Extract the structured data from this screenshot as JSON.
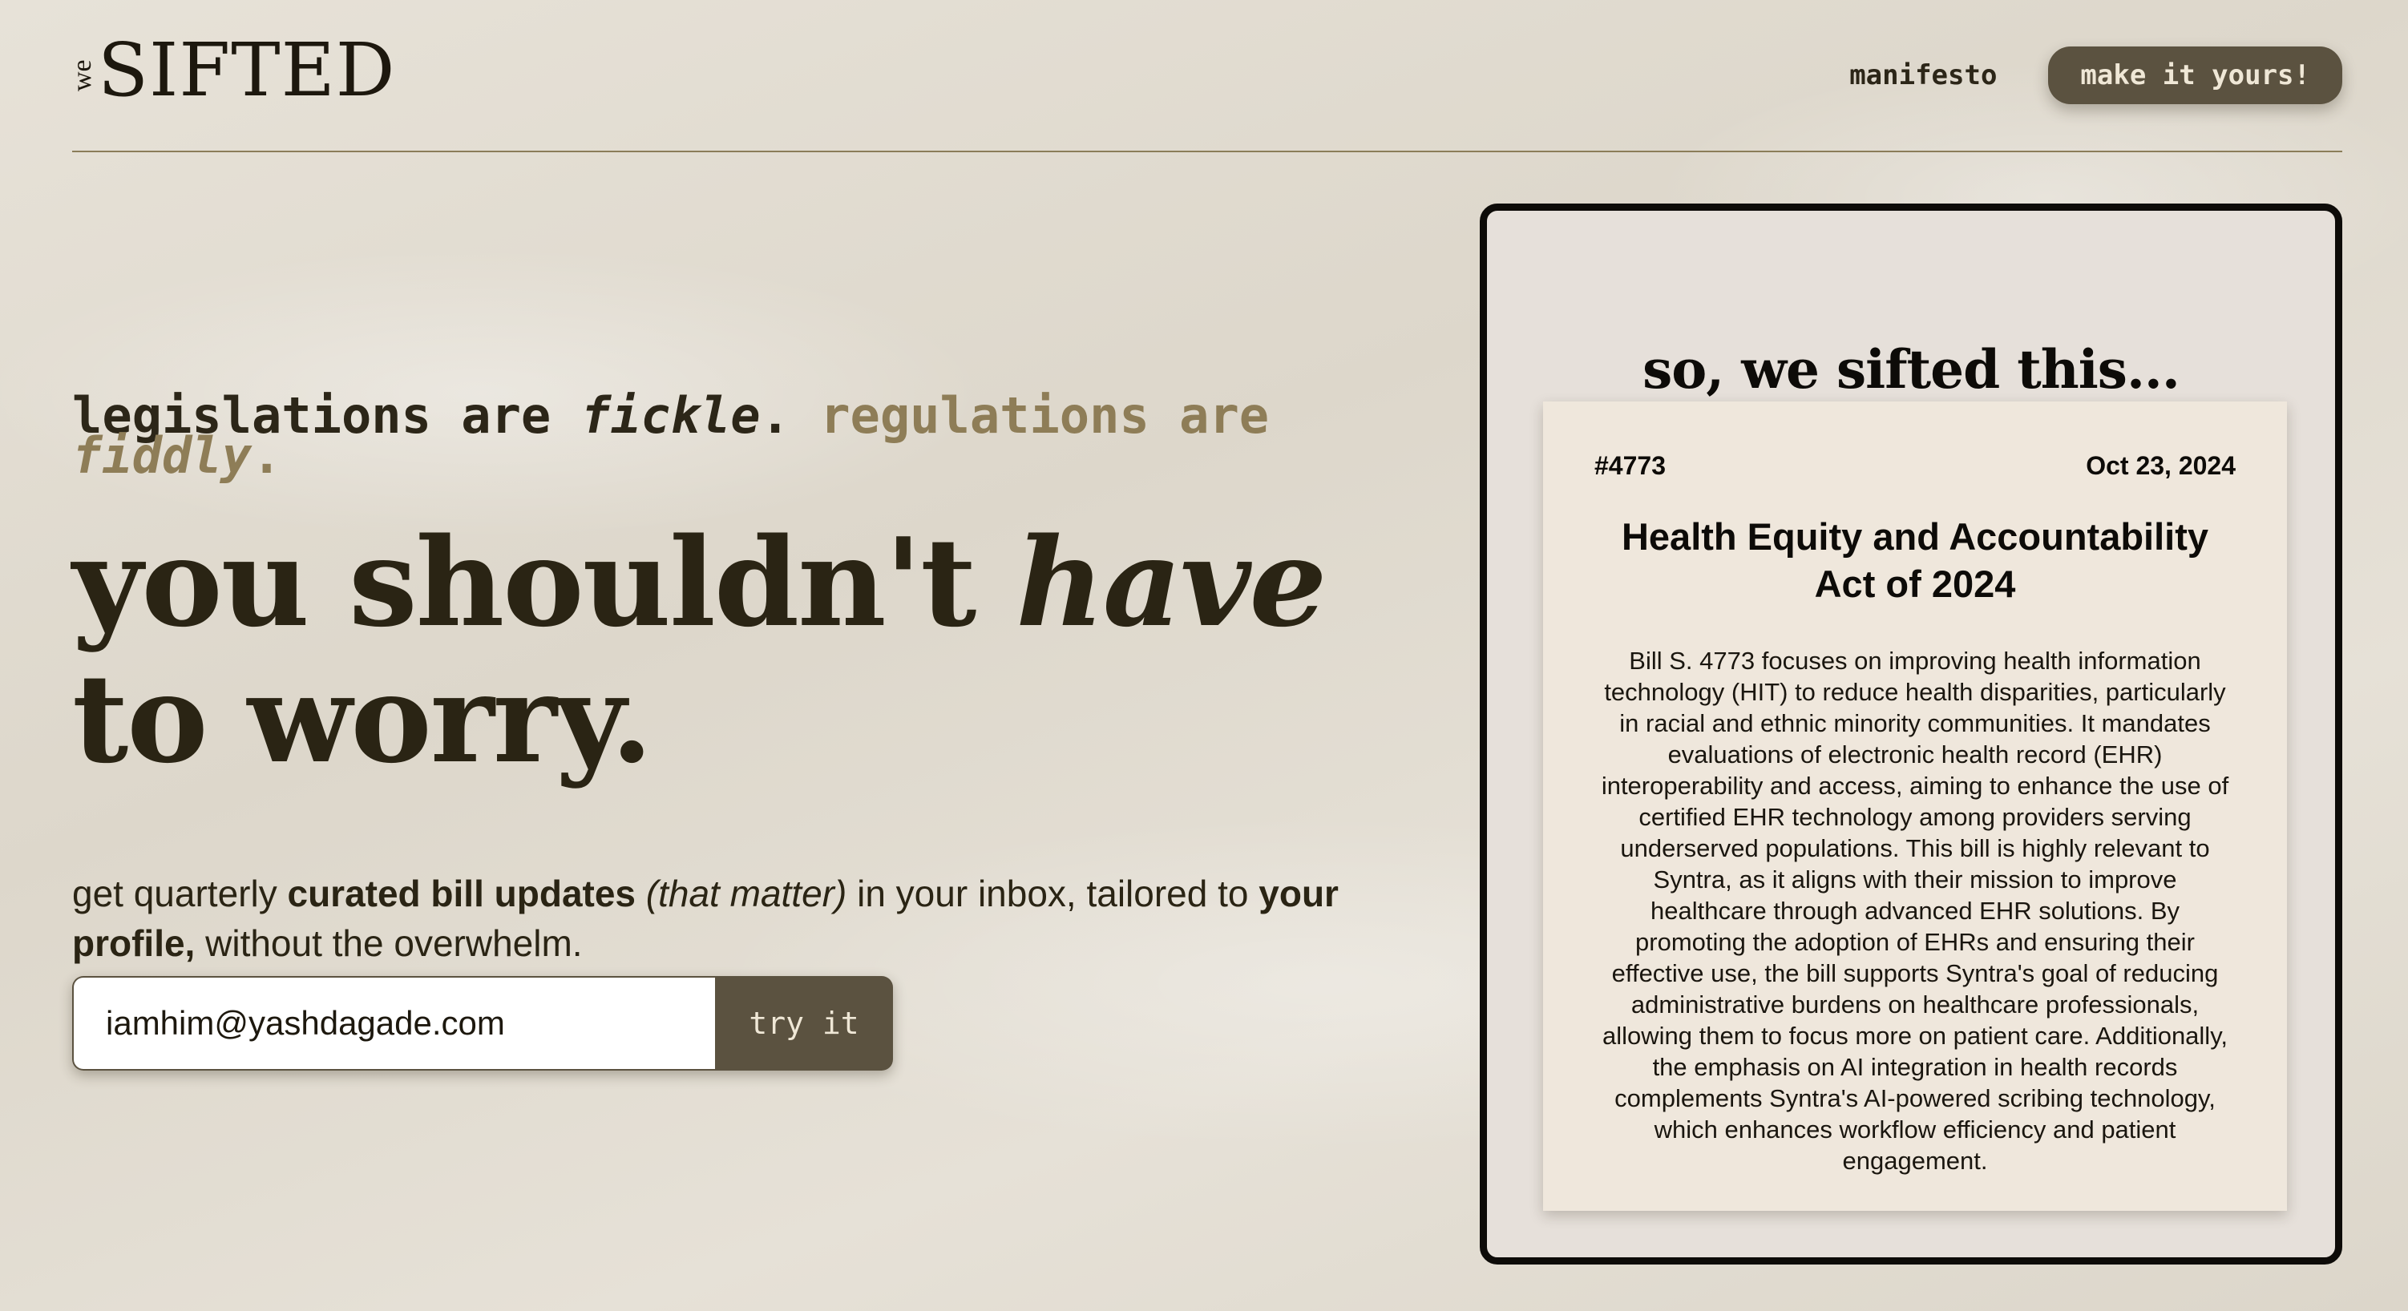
{
  "header": {
    "logo_prefix": "we",
    "logo_name": "SIFTED",
    "nav_manifesto": "manifesto",
    "nav_cta": "make it yours!"
  },
  "hero": {
    "tagline_part1": "legislations are ",
    "tagline_fickle": "fickle",
    "tagline_dot1": ". ",
    "tagline_part2": "regulations are ",
    "tagline_fiddly": "fiddly",
    "tagline_dot2": ".",
    "headline_part1": "you shouldn't ",
    "headline_have": "have",
    "headline_part2": " to worry.",
    "sub_part1": "get quarterly ",
    "sub_bold1": "curated bill updates",
    "sub_italic": " (that matter)",
    "sub_part2": " in your inbox, tailored to ",
    "sub_bold2": "your profile,",
    "sub_part3": " without the overwhelm."
  },
  "signup": {
    "email_value": "iamhim@yashdagade.com",
    "button_label": "try it"
  },
  "preview": {
    "title": "so, we sifted this...",
    "bill_number": "#4773",
    "bill_date": "Oct 23, 2024",
    "bill_title": "Health Equity and Accountability Act of 2024",
    "bill_summary": "Bill S. 4773 focuses on improving health information technology (HIT) to reduce health disparities, particularly in racial and ethnic minority communities. It mandates evaluations of electronic health record (EHR) interoperability and access, aiming to enhance the use of certified EHR technology among providers serving underserved populations. This bill is highly relevant to Syntra, as it aligns with their mission to improve healthcare through advanced EHR solutions. By promoting the adoption of EHRs and ensuring their effective use, the bill supports Syntra's goal of reducing administrative burdens on healthcare professionals, allowing them to focus more on patient care. Additionally, the emphasis on AI integration in health records complements Syntra's AI-powered scribing technology, which enhances workflow efficiency and patient engagement."
  },
  "colors": {
    "background": "#e4dfd5",
    "accent_olive": "#8e7d57",
    "button_dark": "#5b5240",
    "text_dark": "#2a2414",
    "card_bg": "#efe7dc"
  }
}
